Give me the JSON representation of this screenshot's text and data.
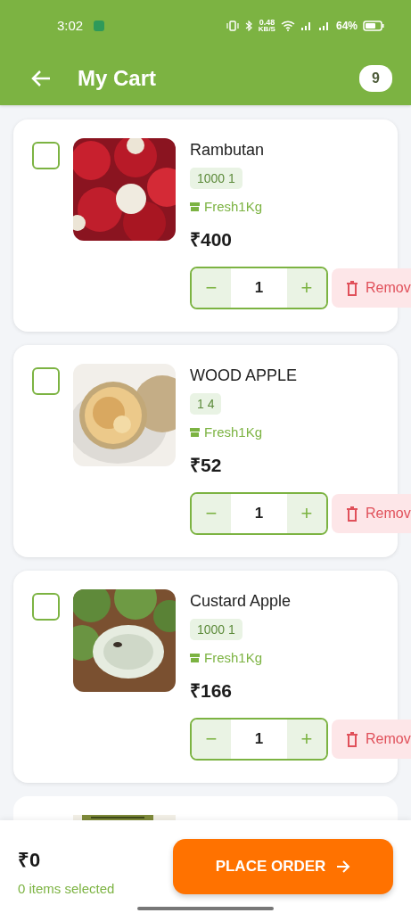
{
  "status_bar": {
    "time": "3:02",
    "speed": "0.48",
    "speed_unit": "KB/S",
    "battery": "64%"
  },
  "header": {
    "title": "My Cart",
    "count": "9"
  },
  "items": [
    {
      "name": "Rambutan",
      "tag": "1000 1",
      "seller": "Fresh1Kg",
      "price": "₹400",
      "quantity": "1",
      "checked": false,
      "remove": "Remov",
      "minus": "−",
      "plus": "+"
    },
    {
      "name": "WOOD APPLE",
      "tag": "1 4",
      "seller": "Fresh1Kg",
      "price": "₹52",
      "quantity": "1",
      "checked": false,
      "remove": "Remov",
      "minus": "−",
      "plus": "+"
    },
    {
      "name": "Custard Apple",
      "tag": "1000 1",
      "seller": "Fresh1Kg",
      "price": "₹166",
      "quantity": "1",
      "checked": false,
      "remove": "Remov",
      "minus": "−",
      "plus": "+"
    }
  ],
  "footer": {
    "total": "₹0",
    "selected": "0 items selected",
    "button": "PLACE ORDER"
  }
}
